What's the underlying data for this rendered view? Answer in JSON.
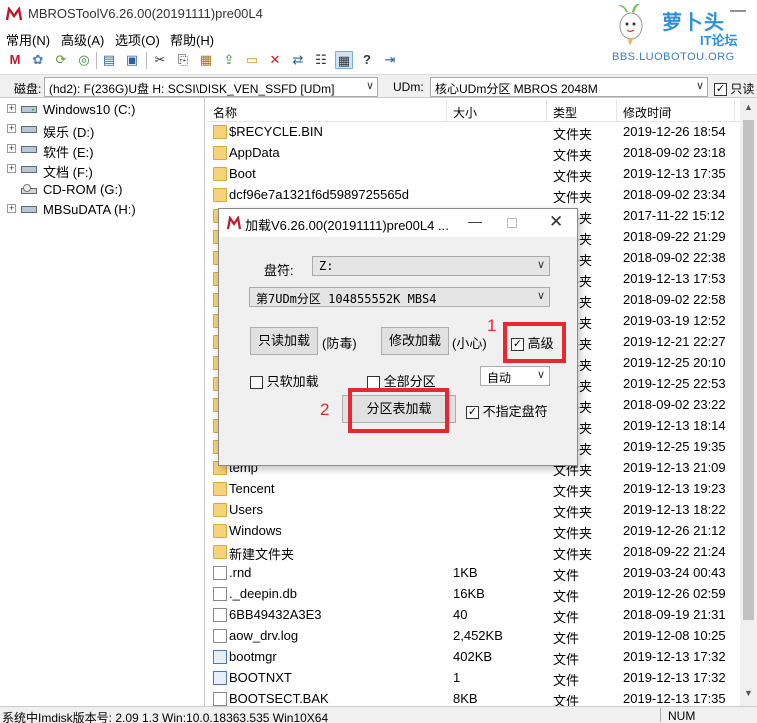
{
  "window": {
    "title": "MBROSToolV6.26.00(20191111)pre00L4",
    "logo": {
      "text_main": "萝卜头",
      "text_sub": "IT论坛",
      "url": "BBS.LUOBOTOU.ORG"
    }
  },
  "menu": [
    "常用(N)",
    "高级(A)",
    "选项(O)",
    "帮助(H)"
  ],
  "drivebar": {
    "disk_label": "磁盘:",
    "disk_value": "(hd2): F(236G)U盘  H: SCSI\\DISK_VEN_SSFD [UDm]",
    "udm_label": "UDm:",
    "udm_value": "核心UDm分区 MBROS 2048M",
    "readonly_label": "只读",
    "readonly_checked": true
  },
  "tree": [
    {
      "label": "Windows10 (C:)",
      "expandable": true,
      "icon": "hard-drive-icon"
    },
    {
      "label": "娱乐 (D:)",
      "expandable": true,
      "icon": "hard-drive-icon"
    },
    {
      "label": "软件 (E:)",
      "expandable": true,
      "icon": "hard-drive-icon"
    },
    {
      "label": "文档 (F:)",
      "expandable": true,
      "icon": "hard-drive-icon"
    },
    {
      "label": "CD-ROM (G:)",
      "expandable": false,
      "icon": "cdrom-icon"
    },
    {
      "label": "MBSuDATA (H:)",
      "expandable": true,
      "icon": "hard-drive-icon"
    }
  ],
  "filelist": {
    "columns": [
      "名称",
      "大小",
      "类型",
      "修改时间"
    ],
    "rows": [
      {
        "name": "$RECYCLE.BIN",
        "size": "",
        "type": "文件夹",
        "date": "2019-12-26 18:54",
        "kind": "folder"
      },
      {
        "name": "AppData",
        "size": "",
        "type": "文件夹",
        "date": "2018-09-02 23:18",
        "kind": "folder"
      },
      {
        "name": "Boot",
        "size": "",
        "type": "文件夹",
        "date": "2019-12-13 17:35",
        "kind": "folder"
      },
      {
        "name": "dcf96e7a1321f6d5989725565d",
        "size": "",
        "type": "文件夹",
        "date": "2018-09-02 23:34",
        "kind": "folder"
      },
      {
        "name": "",
        "size": "",
        "type": "文件夹",
        "date": "2017-11-22 15:12",
        "kind": "folder"
      },
      {
        "name": "",
        "size": "",
        "type": "文件夹",
        "date": "2018-09-22 21:29",
        "kind": "folder"
      },
      {
        "name": "",
        "size": "",
        "type": "文件夹",
        "date": "2018-09-02 22:38",
        "kind": "folder"
      },
      {
        "name": "",
        "size": "",
        "type": "文件夹",
        "date": "2019-12-13 17:53",
        "kind": "folder"
      },
      {
        "name": "",
        "size": "",
        "type": "文件夹",
        "date": "2018-09-02 22:58",
        "kind": "folder"
      },
      {
        "name": "",
        "size": "",
        "type": "文件夹",
        "date": "2019-03-19 12:52",
        "kind": "folder"
      },
      {
        "name": "",
        "size": "",
        "type": "文件夹",
        "date": "2019-12-21 22:27",
        "kind": "folder"
      },
      {
        "name": "",
        "size": "",
        "type": "文件夹",
        "date": "2019-12-25 20:10",
        "kind": "folder"
      },
      {
        "name": "",
        "size": "",
        "type": "文件夹",
        "date": "2019-12-25 22:53",
        "kind": "folder"
      },
      {
        "name": "",
        "size": "",
        "type": "文件夹",
        "date": "2018-09-02 23:22",
        "kind": "folder"
      },
      {
        "name": "",
        "size": "",
        "type": "文件夹",
        "date": "2019-12-13 18:14",
        "kind": "folder"
      },
      {
        "name": "",
        "size": "",
        "type": "文件夹",
        "date": "2019-12-25 19:35",
        "kind": "folder"
      },
      {
        "name": "temp",
        "size": "",
        "type": "文件夹",
        "date": "2019-12-13 21:09",
        "kind": "folder"
      },
      {
        "name": "Tencent",
        "size": "",
        "type": "文件夹",
        "date": "2019-12-13 19:23",
        "kind": "folder"
      },
      {
        "name": "Users",
        "size": "",
        "type": "文件夹",
        "date": "2019-12-13 18:22",
        "kind": "folder"
      },
      {
        "name": "Windows",
        "size": "",
        "type": "文件夹",
        "date": "2019-12-26 21:12",
        "kind": "folder"
      },
      {
        "name": "新建文件夹",
        "size": "",
        "type": "文件夹",
        "date": "2018-09-22 21:24",
        "kind": "folder"
      },
      {
        "name": ".rnd",
        "size": "1KB",
        "type": "文件",
        "date": "2019-03-24 00:43",
        "kind": "file"
      },
      {
        "name": "._deepin.db",
        "size": "16KB",
        "type": "文件",
        "date": "2019-12-26 02:59",
        "kind": "file"
      },
      {
        "name": "6BB49432A3E3",
        "size": "40",
        "type": "文件",
        "date": "2018-09-19 21:31",
        "kind": "file"
      },
      {
        "name": "aow_drv.log",
        "size": "2,452KB",
        "type": "文件",
        "date": "2019-12-08 10:25",
        "kind": "file"
      },
      {
        "name": "bootmgr",
        "size": "402KB",
        "type": "文件",
        "date": "2019-12-13 17:32",
        "kind": "exe"
      },
      {
        "name": "BOOTNXT",
        "size": "1",
        "type": "文件",
        "date": "2019-12-13 17:32",
        "kind": "exe"
      },
      {
        "name": "BOOTSECT.BAK",
        "size": "8KB",
        "type": "文件",
        "date": "2019-12-13 17:35",
        "kind": "file"
      }
    ]
  },
  "status": {
    "left": "系统中Imdisk版本号: 2.09 1.3    Win:10.0.18363.535 Win10X64",
    "num": "NUM"
  },
  "dialog": {
    "title": "加载V6.26.00(20191111)pre00L4 ...",
    "drive_letter_label": "盘符:",
    "drive_letter_value": "Z:",
    "partition_value": "第7UDm分区 104855552K MBS4",
    "readonly_load_button": "只读加载",
    "antivirus_note": "(防毒)",
    "modify_load_button": "修改加载",
    "careful_note": "(小心)",
    "advanced_label": "高级",
    "advanced_checked": true,
    "soft_load_label": "只软加载",
    "soft_load_checked": false,
    "all_partitions_label": "全部分区",
    "all_partitions_checked": false,
    "mode_value": "自动",
    "partition_table_load_button": "分区表加载",
    "no_drive_letter_label": "不指定盘符",
    "no_drive_letter_checked": true
  },
  "annotations": {
    "marker_1": "1",
    "marker_2": "2",
    "highlight_color": "#e8272f"
  }
}
